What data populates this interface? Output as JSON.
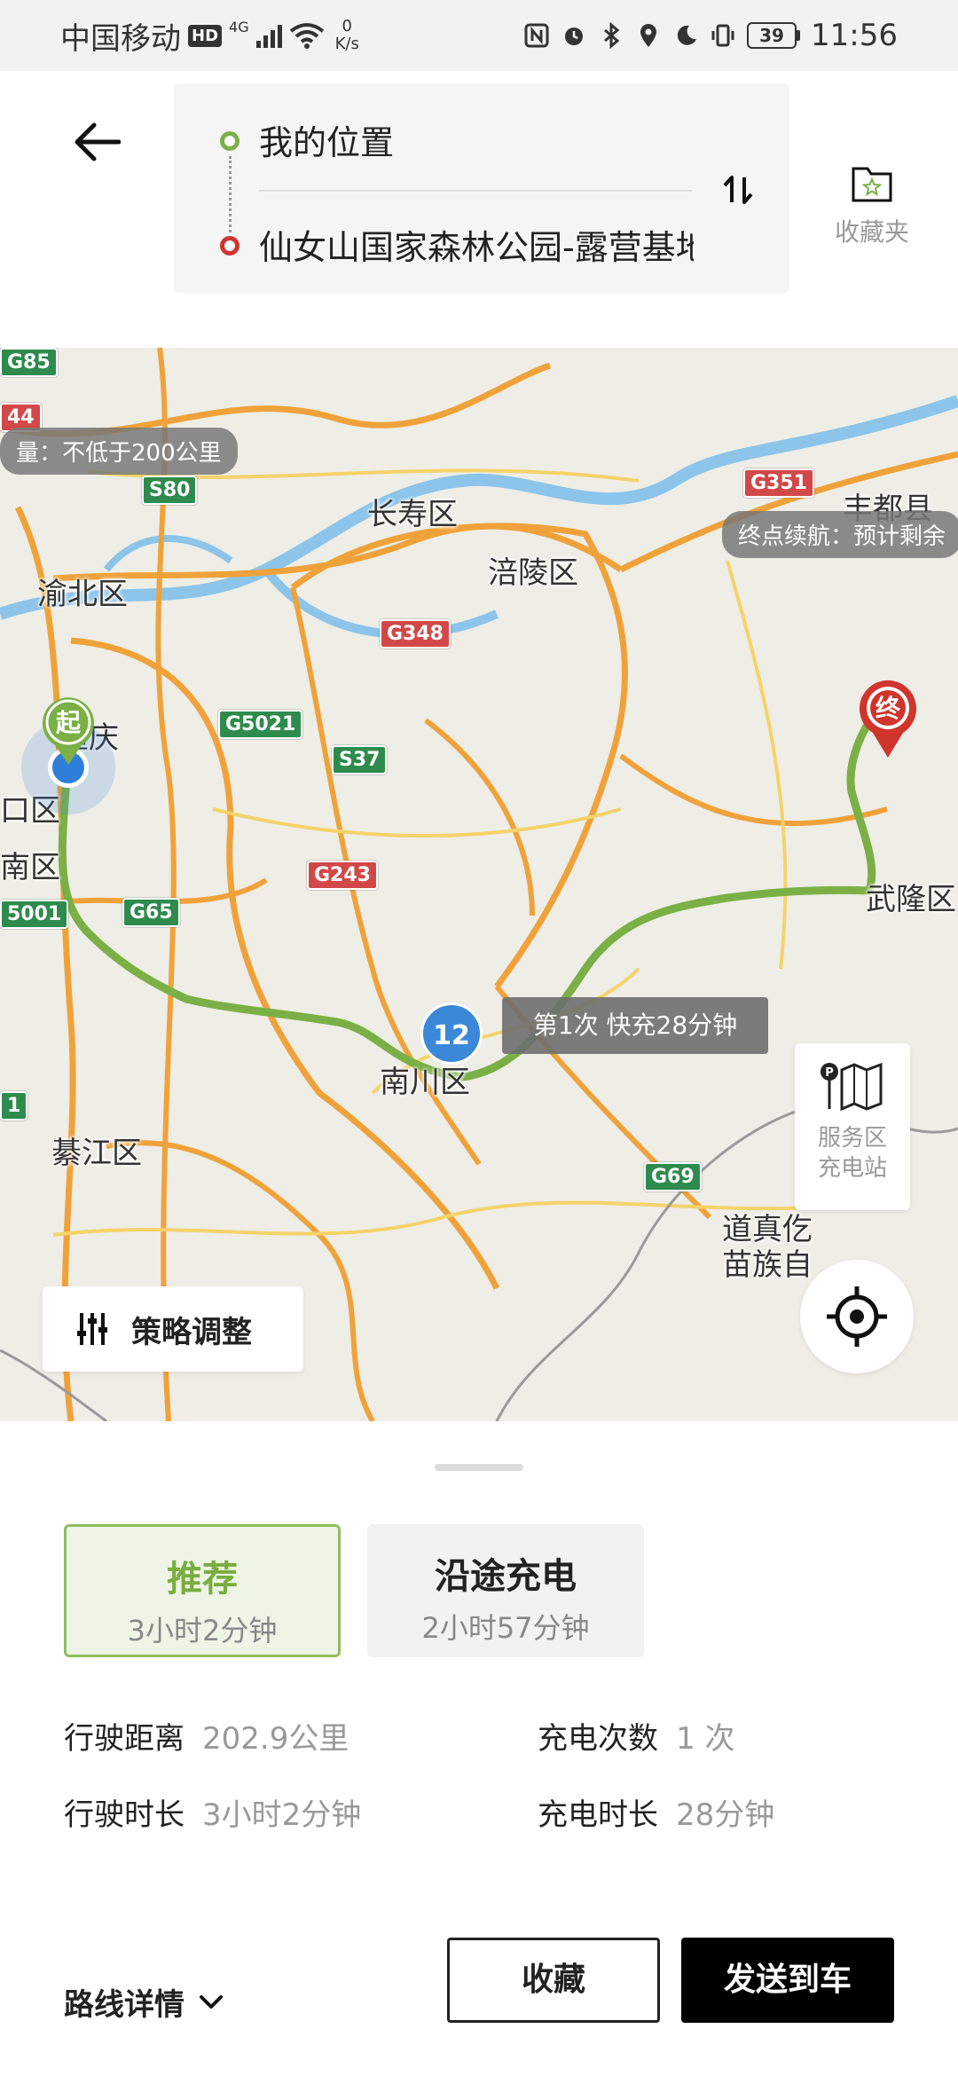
{
  "status_bar": {
    "carrier": "中国移动",
    "hd": "HD",
    "network": "4G",
    "speed_value": "0",
    "speed_unit": "K/s",
    "battery": "39",
    "time": "11:56"
  },
  "route": {
    "from": "我的位置",
    "to": "仙女山国家森林公园-露营基地"
  },
  "header": {
    "favorites_label": "收藏夹"
  },
  "map": {
    "places": {
      "changshou": "长寿区",
      "fuling": "涪陵区",
      "fengdu": "丰都县",
      "yubei": "渝北区",
      "chongqing": "重庆",
      "jiulongpo": "口区",
      "banan": "南区",
      "nanchuan": "南川区",
      "qijiang": "綦江区",
      "wulong": "武隆区",
      "daozhen_1": "道真仡",
      "daozhen_2": "苗族自"
    },
    "shields": {
      "g85": "G85",
      "s80": "S80",
      "g44": "44",
      "g351": "G351",
      "g348": "G348",
      "g5021": "G5021",
      "s37": "S37",
      "g243": "G243",
      "g65": "G65",
      "g5001": "5001",
      "g69": "G69",
      "g21": "1"
    },
    "range_tip": "量：不低于200公里",
    "end_range_tip": "终点续航：预计剩余",
    "start_pin": "起",
    "end_pin": "终",
    "charge_badge": "12",
    "charge_tip": "第1次 快充28分钟",
    "strategy_label": "策略调整",
    "service_label_1": "服务区",
    "service_label_2": "充电站"
  },
  "tabs": [
    {
      "title": "推荐",
      "duration": "3小时2分钟"
    },
    {
      "title": "沿途充电",
      "duration": "2小时57分钟"
    }
  ],
  "stats": {
    "distance_label": "行驶距离",
    "distance_value": "202.9公里",
    "duration_label": "行驶时长",
    "duration_value": "3小时2分钟",
    "charge_count_label": "充电次数",
    "charge_count_value": "1 次",
    "charge_time_label": "充电时长",
    "charge_time_value": "28分钟"
  },
  "footer": {
    "details_label": "路线详情",
    "favorite_button": "收藏",
    "send_button": "发送到车"
  },
  "colors": {
    "route_green": "#7ab045",
    "accent_red": "#d0342c",
    "charge_blue": "#3b88d9",
    "highway_orange": "#f0a23a"
  }
}
